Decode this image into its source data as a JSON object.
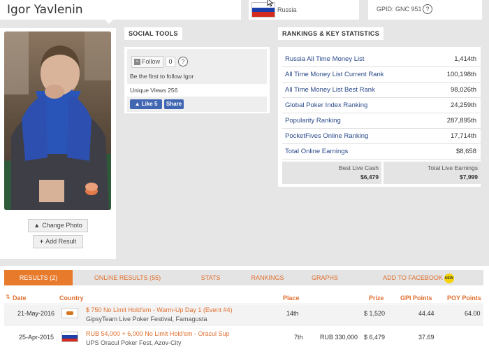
{
  "player": {
    "name": "Igor Yavlenin"
  },
  "country": {
    "name": "Russia"
  },
  "gpid": {
    "label": "GPID: GNC 951",
    "help": "?"
  },
  "photo_panel": {
    "change_photo": "Change Photo",
    "add_result": "Add Result"
  },
  "social": {
    "title": "SOCIAL TOOLS",
    "follow_label": "Follow",
    "follow_count": "0",
    "help": "?",
    "first_follow": "Be the first to follow Igor",
    "unique_views": "Unique Views 256",
    "like_label": "Like 5",
    "share_label": "Share"
  },
  "rankings": {
    "title": "RANKINGS & KEY STATISTICS",
    "rows": [
      {
        "label": "Russia All Time Money List",
        "value": "1,414th"
      },
      {
        "label": "All Time Money List Current Rank",
        "value": "100,198th"
      },
      {
        "label": "All Time Money List Best Rank",
        "value": "98,026th"
      },
      {
        "label": "Global Poker Index Ranking",
        "value": "24,259th"
      },
      {
        "label": "Popularity Ranking",
        "value": "287,895th"
      },
      {
        "label": "PocketFives Online Ranking",
        "value": "17,714th"
      },
      {
        "label": "Total Online Earnings",
        "value": "$8,658"
      }
    ],
    "best_live_cash_label": "Best Live Cash",
    "best_live_cash_value": "$6,479",
    "total_live_label": "Total Live Earnings",
    "total_live_value": "$7,999"
  },
  "tabs": [
    {
      "label": "RESULTS (2)",
      "active": true
    },
    {
      "label": "ONLINE RESULTS (55)"
    },
    {
      "label": "STATS"
    },
    {
      "label": "RANKINGS"
    },
    {
      "label": "GRAPHS"
    },
    {
      "label": "ADD TO FACEBOOK",
      "badge": "NEW"
    }
  ],
  "results_headers": {
    "date": "Date",
    "country": "Country",
    "place": "Place",
    "prize": "Prize",
    "gpi": "GPI Points",
    "poy": "POY Points"
  },
  "results": [
    {
      "date": "21-May-2016",
      "event": "$ 750 No Limit Hold'em - Warm-Up Day 1 (Event #4)",
      "festival": "GipsyTeam Live Poker Festival, Famagusta",
      "place": "14th",
      "local_prize": "",
      "prize": "$ 1,520",
      "gpi": "44.44",
      "poy": "64.00"
    },
    {
      "date": "25-Apr-2015",
      "event": "RUB 54,000 + 6,000 No Limit Hold'em - Oracul Sup",
      "festival": "UPS Oracul Poker Fest, Azov-City",
      "place": "7th",
      "local_prize": "RUB 330,000",
      "prize": "$ 6,479",
      "gpi": "37.69",
      "poy": ""
    }
  ]
}
